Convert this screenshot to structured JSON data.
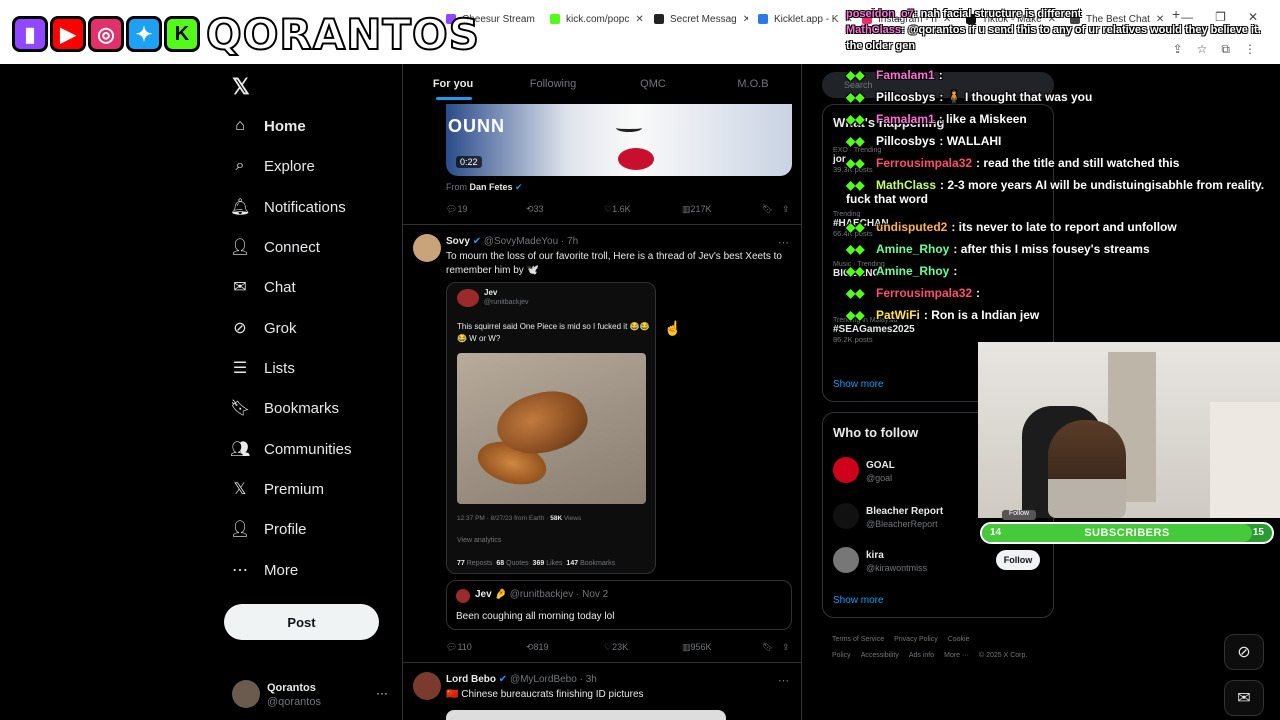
{
  "browser": {
    "tabs": [
      {
        "label": "Cheesur Stream",
        "color": "#9146ff"
      },
      {
        "label": "kick.com/popc",
        "color": "#53fc18"
      },
      {
        "label": "Secret Messag",
        "color": "#222222"
      },
      {
        "label": "Kicklet.app - K",
        "color": "#2a7be4"
      },
      {
        "label": "Instagram - h",
        "color": "#e1306c"
      },
      {
        "label": "Tiktok - Make",
        "color": "#111111"
      },
      {
        "label": "The Best Chat",
        "color": "#444444"
      }
    ]
  },
  "overlay": {
    "logo_text": "QORANTOS",
    "top_chat": [
      {
        "user": "poseidon_o7",
        "text": ": nah facial structure is different"
      },
      {
        "user": "MathClass",
        "text": ": @qorantos if u send this to any of ur relatives would they believe it. the older gen"
      }
    ],
    "chat": [
      {
        "user": "Famalam1",
        "text": ":",
        "color": "#ff6fd8"
      },
      {
        "user": "Pillcosbys",
        "text": ": 🧍 I thought that was you",
        "color": "#ffffff"
      },
      {
        "user": "Famalam1",
        "text": ": like a Miskeen",
        "color": "#ff6fd8"
      },
      {
        "user": "Pillcosbys",
        "text": ": WALLAHI",
        "color": "#ffffff"
      },
      {
        "user": "Ferrousimpala32",
        "text": ": read the title and still watched this",
        "color": "#ff4d6d"
      },
      {
        "user": "MathClass",
        "text": ": 2-3 more years AI will be undistuingisabhle from reality. fuck that word",
        "color": "#c6ff6b"
      },
      {
        "user": "undisputed2",
        "text": ": its never to late to report and unfollow",
        "color": "#ffb347"
      },
      {
        "user": "Amine_Rhoy",
        "text": ": after this I miss fousey's streams",
        "color": "#6bff9c"
      },
      {
        "user": "Amine_Rhoy",
        "text": ":",
        "color": "#6bff9c"
      },
      {
        "user": "Ferrousimpala32",
        "text": ":",
        "color": "#ff4d6d"
      },
      {
        "user": "PatWiFi",
        "text": ": Ron is a Indian jew",
        "color": "#ffe14d"
      }
    ],
    "sub_goal": {
      "current": "14",
      "label": "SUBSCRIBERS",
      "target": "15",
      "progress": 0.93
    },
    "cam_follow": "Follow"
  },
  "nav": {
    "items": [
      {
        "label": "Home",
        "icon": "⌂",
        "name": "home"
      },
      {
        "label": "Explore",
        "icon": "⌕",
        "name": "explore"
      },
      {
        "label": "Notifications",
        "icon": "🔔︎",
        "name": "notifications"
      },
      {
        "label": "Connect",
        "icon": "👤︎",
        "name": "connect"
      },
      {
        "label": "Chat",
        "icon": "✉",
        "name": "chat"
      },
      {
        "label": "Grok",
        "icon": "⊘",
        "name": "grok"
      },
      {
        "label": "Lists",
        "icon": "☰",
        "name": "lists"
      },
      {
        "label": "Bookmarks",
        "icon": "🔖︎",
        "name": "bookmarks"
      },
      {
        "label": "Communities",
        "icon": "👥︎",
        "name": "communities"
      },
      {
        "label": "Premium",
        "icon": "𝕏",
        "name": "premium"
      },
      {
        "label": "Profile",
        "icon": "👤︎",
        "name": "profile"
      },
      {
        "label": "More",
        "icon": "⋯",
        "name": "more"
      }
    ],
    "post_label": "Post",
    "account": {
      "name": "Qorantos",
      "handle": "@qorantos"
    }
  },
  "feed": {
    "tabs": [
      "For you",
      "Following",
      "QMC",
      "M.O.B"
    ],
    "video_post": {
      "brand_text": "OUNN",
      "duration": "0:22",
      "from_label": "From",
      "from_name": "Dan Fetes",
      "replies": "19",
      "reposts": "33",
      "likes": "1.6K",
      "views": "217K"
    },
    "sovy_post": {
      "name": "Sovy",
      "handle": "@SovyMadeYou",
      "time": "· 7h",
      "text": "To mourn the loss of our favorite troll, Here is a thread of Jev's best Xeets to remember him by 🕊️",
      "quote": {
        "name": "Jev",
        "handle": "@runitbackjev",
        "text": "This squirrel said One Piece is mid so I fucked it 😂😂😂 W or W?",
        "meta": "12:37 PM · 8/27/23 from Earth ·",
        "views": "58K",
        "views_label": "Views",
        "analytics": "View analytics",
        "reposts": "77",
        "reposts_label": "Reposts",
        "quotes": "68",
        "quotes_label": "Quotes",
        "likes": "369",
        "likes_label": "Likes",
        "bookmarks": "147",
        "bookmarks_label": "Bookmarks"
      },
      "reply": {
        "name": "Jev 🤌",
        "handle": "@runitbackjev",
        "time": "· Nov 2",
        "text": "Been coughing all morning today lol"
      },
      "replies": "110",
      "reposts": "819",
      "likes": "23K",
      "views": "956K"
    },
    "lord_post": {
      "name": "Lord Bebo",
      "handle": "@MyLordBebo",
      "time": "· 3h",
      "text": "🇨🇳 Chinese bureaucrats finishing ID pictures"
    }
  },
  "right": {
    "search_placeholder": "Search",
    "happening_title": "What's happening",
    "trends": [
      {
        "cat": "EXO · Trending",
        "name": "jor",
        "count": "39.3K posts"
      },
      {
        "cat": "Trending",
        "name": "#HAECHAN",
        "count": "66.4K posts"
      },
      {
        "cat": "Music · Trending",
        "name": "BIGBANG",
        "count": ""
      },
      {
        "cat": "Trending in Malaysia",
        "name": "#SEAGames2025",
        "count": "86.2K posts"
      }
    ],
    "show_more": "Show more",
    "who_to_follow": "Who to follow",
    "follow_suggestions": [
      {
        "name": "GOAL",
        "handle": "@goal",
        "color": "#d0021b"
      },
      {
        "name": "Bleacher Report",
        "handle": "@BleacherReport",
        "color": "#111111"
      },
      {
        "name": "kira",
        "handle": "@kirawontmiss",
        "color": "#777777"
      }
    ],
    "follow_label": "Follow",
    "show_more_2": "Show more",
    "footer": [
      "Terms of Service",
      "Privacy Policy",
      "Cookie Policy",
      "Accessibility",
      "Ads info",
      "More ···",
      "© 2025 X Corp."
    ]
  }
}
